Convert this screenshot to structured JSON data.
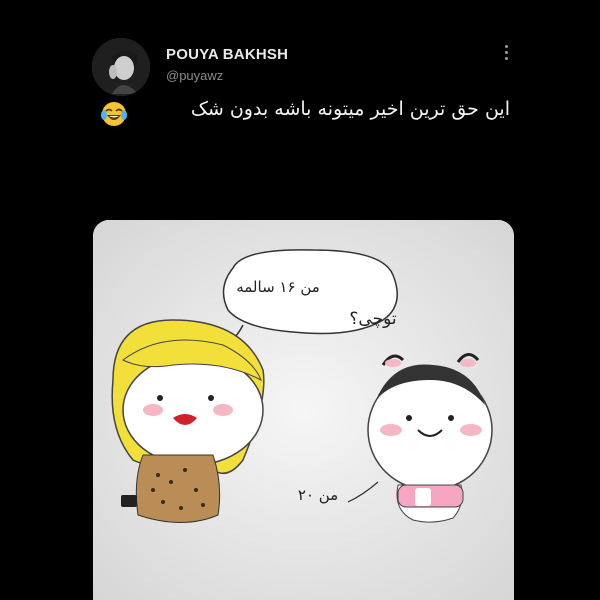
{
  "tweet": {
    "author_name": "POUYA BAKHSH",
    "author_handle": "@puyawz",
    "text": "این حق ترین اخیر میتونه باشه بدون شک",
    "emoji": "tears-of-joy-emoji"
  },
  "media": {
    "bubble_top": "من ۱۶ سالمه",
    "bubble_mid": "توچی؟",
    "bubble_bottom": "من ۲۰"
  },
  "icons": [
    "more-options-icon",
    "tears-of-joy-emoji"
  ]
}
